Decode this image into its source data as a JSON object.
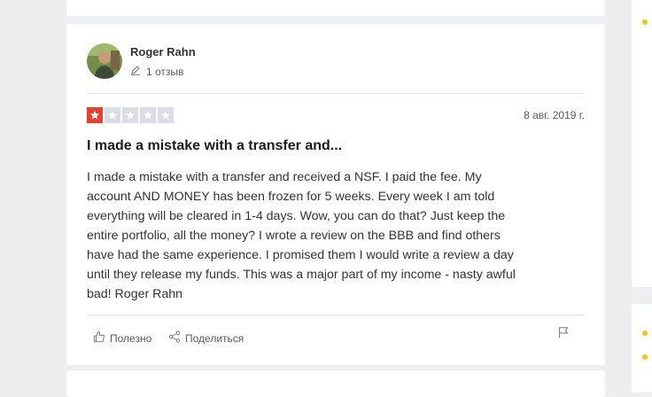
{
  "review": {
    "reviewer_name": "Roger Rahn",
    "reviews_count": "1 отзыв",
    "rating": 1,
    "max_rating": 5,
    "date": "8 авг. 2019 г.",
    "title": "I made a mistake with a transfer and...",
    "body": "I made a mistake with a transfer and received a NSF. I paid the fee. My\naccount AND MONEY has been frozen for 5 weeks. Every week I am told\neverything will be cleared in 1-4 days. Wow, you can do that? Just keep the\nentire portfolio, all the money? I wrote a review on the BBB and find others\nhave had the same experience. I promised them I would write a review a day\nuntil they release my funds. This was a major part of my income - nasty awful\nbad! Roger Rahn",
    "actions": {
      "useful_label": "Полезно",
      "share_label": "Поделиться"
    }
  },
  "colors": {
    "star_filled": "#e8402f",
    "star_empty": "#dcdce6",
    "page_background": "#eceef0"
  },
  "icons": [
    "pencil-icon",
    "thumbs-up-icon",
    "share-icon",
    "flag-icon",
    "star-icon"
  ]
}
